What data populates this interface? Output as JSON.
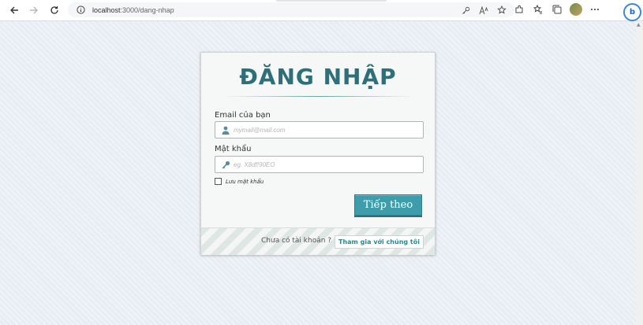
{
  "browser": {
    "url_host": "localhost",
    "url_path": ":3000/dang-nhap"
  },
  "form": {
    "title": "ĐĂNG NHẬP",
    "email_label": "Email của bạn",
    "email_placeholder": "mymail@mail.com",
    "password_label": "Mật khẩu",
    "password_placeholder": "eg. X8df!90EO",
    "remember_label": "Lưu mật khẩu",
    "submit_label": "Tiếp theo"
  },
  "footer": {
    "question": "Chưa có tài khoản ?",
    "join_label": "Tham gia với chúng tôi"
  },
  "colors": {
    "accent": "#3e9dab",
    "title": "#2f6f79"
  }
}
